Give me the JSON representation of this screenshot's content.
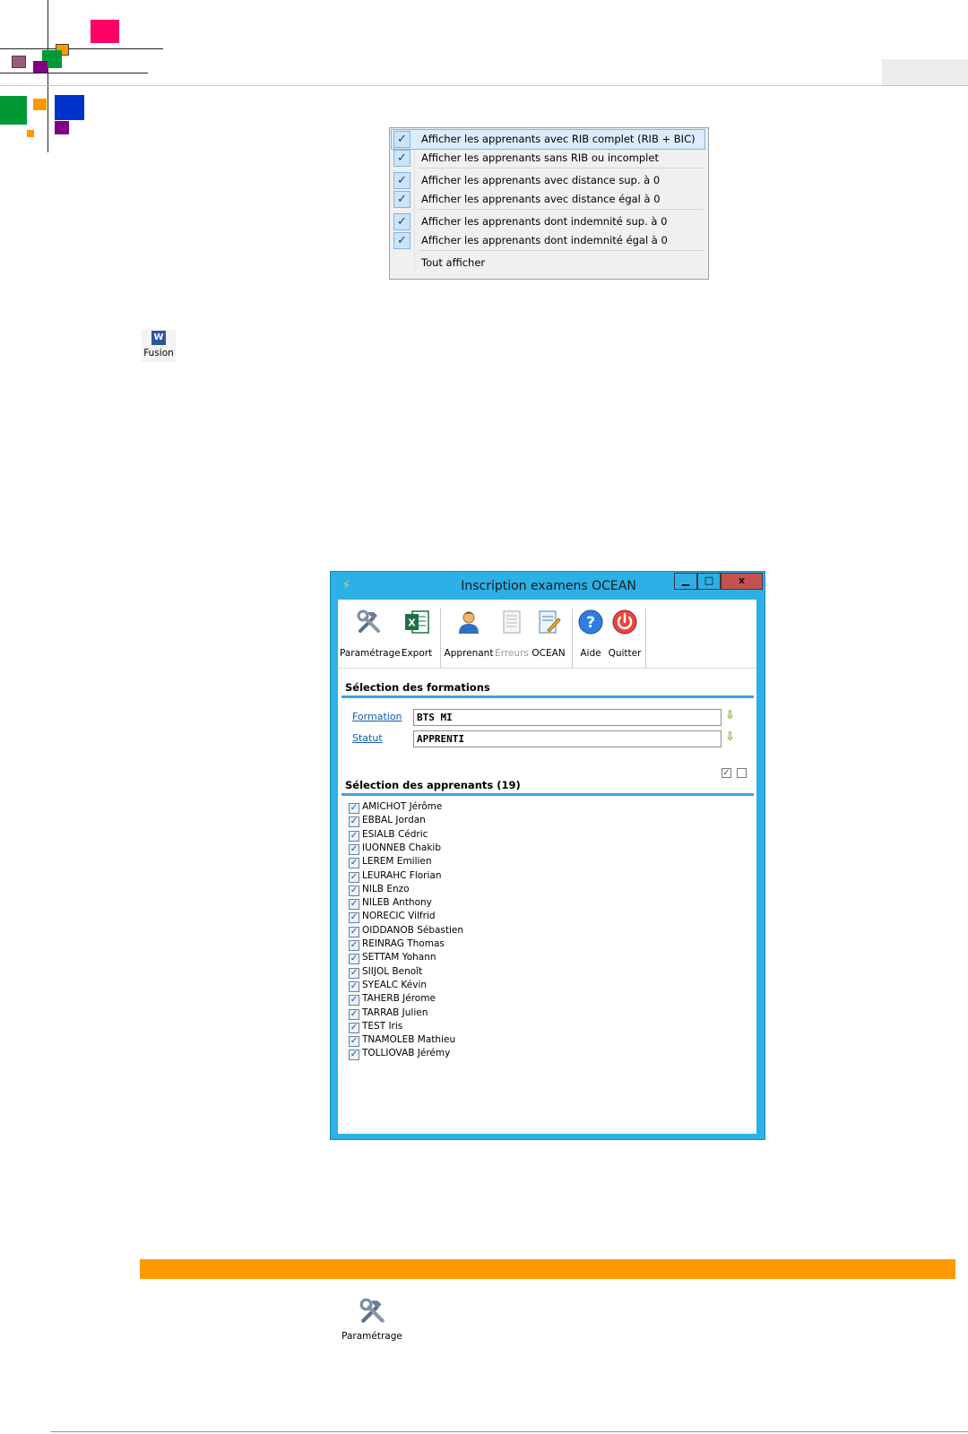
{
  "colors": {
    "logo_pink": "#ff0066",
    "logo_orange": "#ff9900",
    "logo_green": "#009933",
    "logo_purple": "#800080",
    "logo_mauve": "#9c5a7a",
    "logo_blue": "#0033cc",
    "window_frame": "#2cb0e6",
    "close_button": "#c7514e",
    "section_rule": "#3ba3dd",
    "link_blue": "#0b5fb3",
    "orange_band": "#ff9900"
  },
  "context_menu": {
    "items": [
      {
        "label": "Afficher les apprenants avec RIB complet (RIB + BIC)",
        "checked": true,
        "highlighted": true
      },
      {
        "label": "Afficher les apprenants sans RIB ou incomplet",
        "checked": true
      },
      {
        "label": "Afficher les apprenants avec distance sup. à 0",
        "checked": true
      },
      {
        "label": "Afficher les apprenants avec distance égal à 0",
        "checked": true
      },
      {
        "label": "Afficher les apprenants dont indemnité sup. à 0",
        "checked": true
      },
      {
        "label": "Afficher les apprenants dont indemnité égal à 0",
        "checked": true
      },
      {
        "label": "Tout afficher",
        "checked": false
      }
    ],
    "check_glyph": "✓"
  },
  "fusion_button": {
    "label": "Fusion",
    "icon": "word-icon",
    "icon_letter": "W"
  },
  "window": {
    "title": "Inscription examens OCEAN",
    "app_icon": "⚡",
    "min_glyph": "▁",
    "max_glyph": "□",
    "close_glyph": "x",
    "toolbar": [
      {
        "label": "Paramétrage",
        "icon": "tools-icon",
        "accel": "P"
      },
      {
        "label": "Export",
        "icon": "excel-icon",
        "accel": "E"
      },
      {
        "label": "Apprenant",
        "icon": "user-icon",
        "accel": "A"
      },
      {
        "label": "Erreurs",
        "icon": "document-icon",
        "accel": "E",
        "disabled": true
      },
      {
        "label": "OCEAN",
        "icon": "form-icon",
        "accel": "O"
      },
      {
        "label": "Aide",
        "icon": "help-icon",
        "accel": "i"
      },
      {
        "label": "Quitter",
        "icon": "power-icon",
        "accel": "Q"
      }
    ],
    "formations_section": {
      "title": "Sélection des formations",
      "formation_label": "Formation",
      "formation_value": "BTS MI",
      "statut_label": "Statut",
      "statut_value": "APPRENTI"
    },
    "learners_section": {
      "title": "Sélection des apprenants (19)",
      "select_all_glyph": "✓",
      "learners": [
        "AMICHOT Jérôme",
        "EBBAL Jordan",
        "ESIALB Cédric",
        "IUONNEB Chakib",
        "LEREM Emilien",
        "LEURAHC Florian",
        "NILB Enzo",
        "NILEB Anthony",
        "NORECIC Vilfrid",
        "OIDDANOB Sébastien",
        "REINRAG Thomas",
        "SETTAM Yohann",
        "SIIJOL Benoît",
        "SYEALC Kévin",
        "TAHERB Jérome",
        "TARRAB Julien",
        "TEST Iris",
        "TNAMOLEB Mathieu",
        "TOLLIOVAB Jérémy"
      ],
      "all_checked": true
    }
  },
  "bottom_parametrage": {
    "label": "Paramétrage",
    "icon": "tools-icon"
  }
}
